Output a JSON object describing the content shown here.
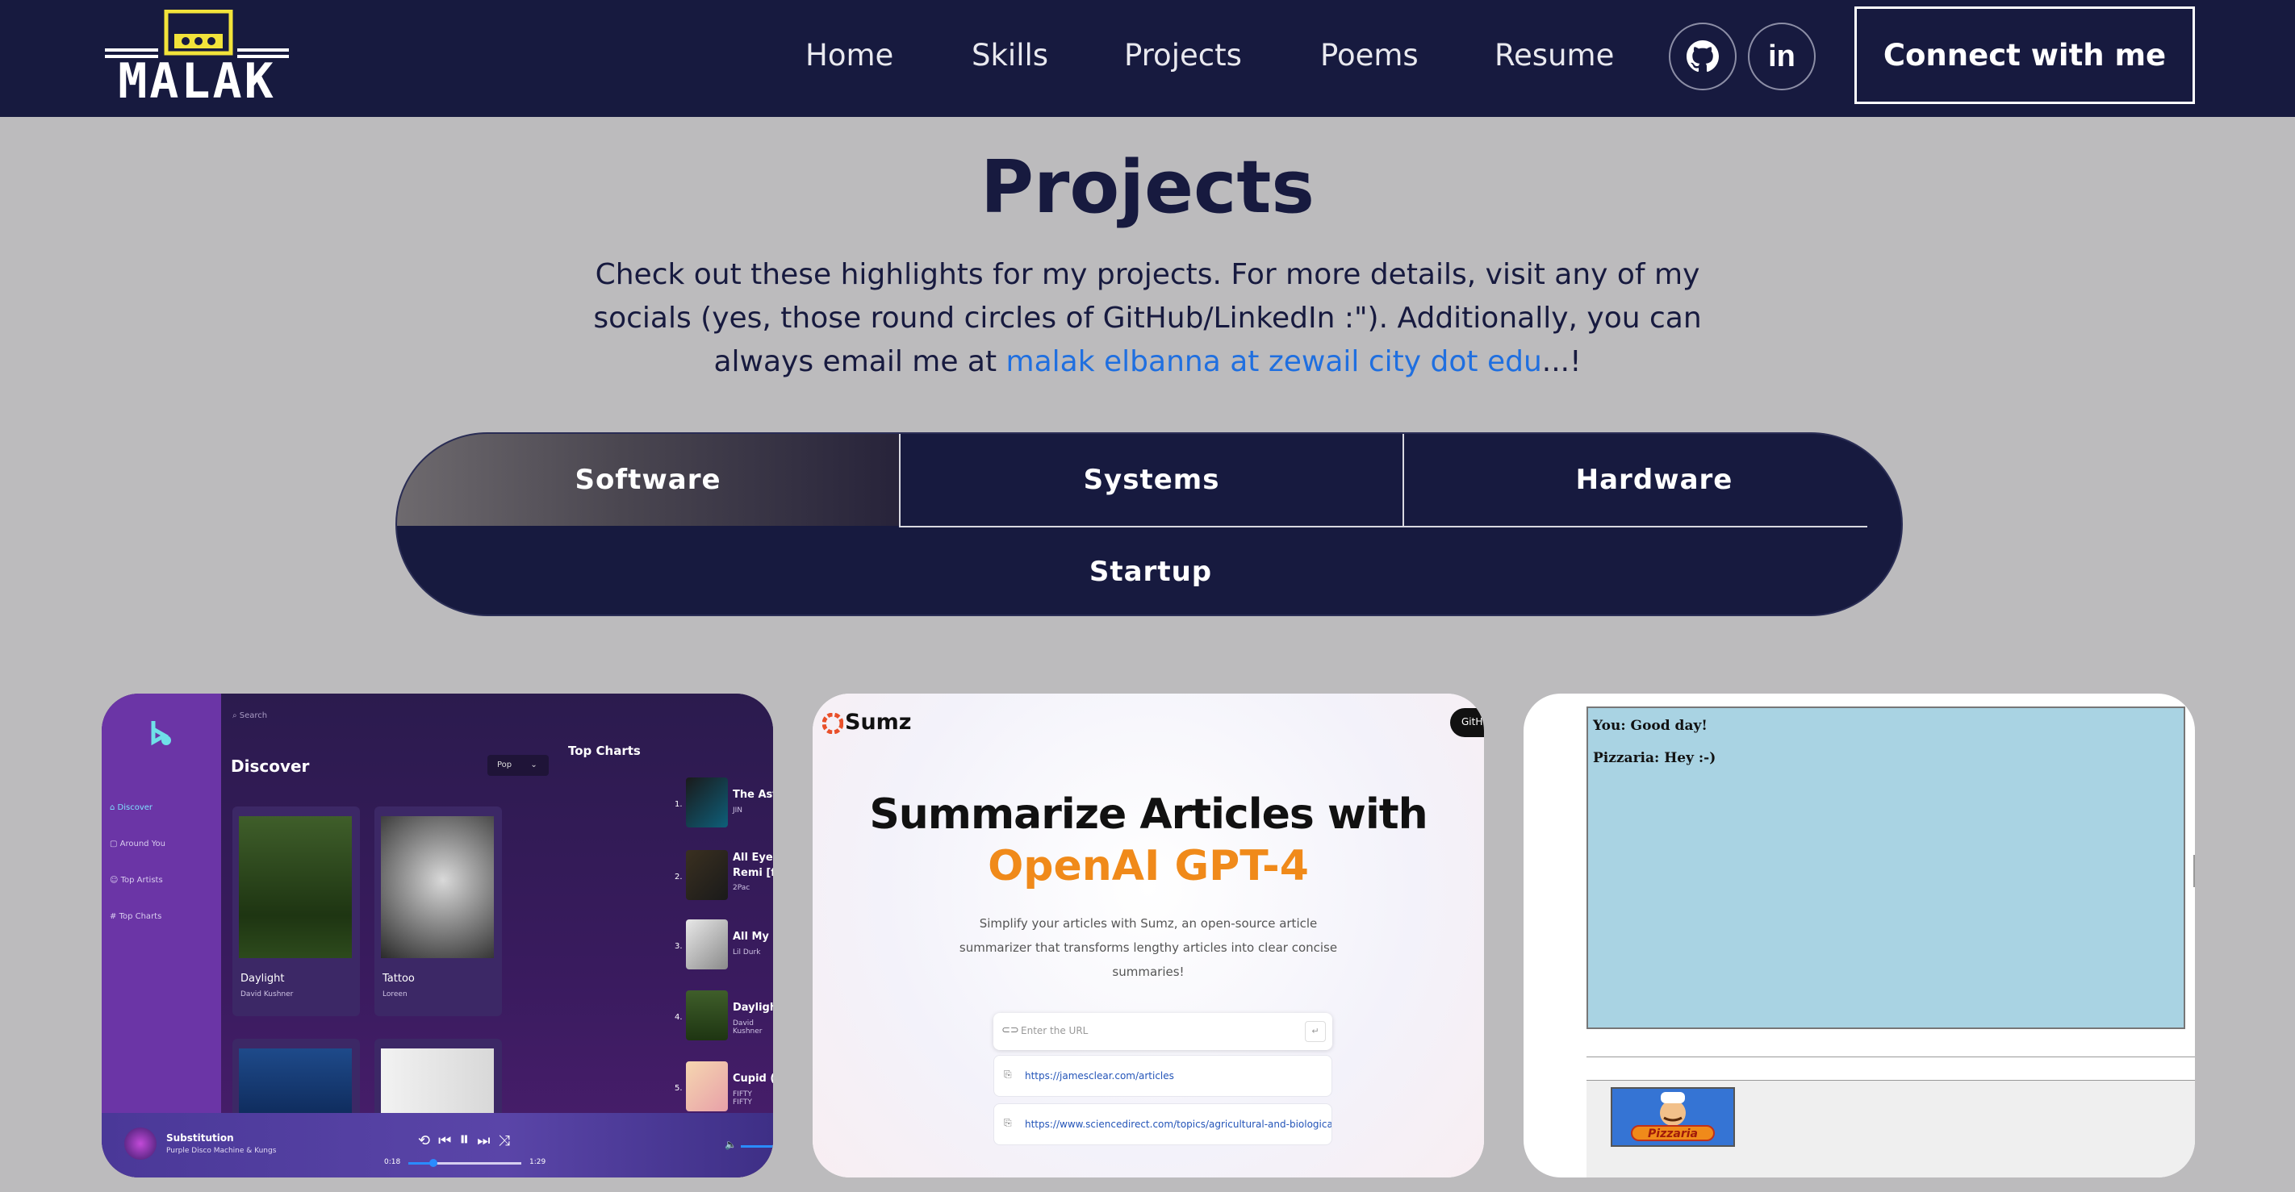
{
  "brand": {
    "name": "MALAK"
  },
  "nav": {
    "links": [
      "Home",
      "Skills",
      "Projects",
      "Poems",
      "Resume"
    ],
    "connect_label": "Connect with me",
    "github_icon": "github-icon",
    "linkedin_icon": "linkedin-icon",
    "linkedin_text": "in"
  },
  "page": {
    "title": "Projects",
    "intro_before": "Check out these highlights for my projects. For more details, visit any of my socials (yes, those round circles of GitHub/LinkedIn :\"). Additionally, you can always email me at ",
    "email_text": "malak elbanna at zewail city dot edu",
    "intro_after": "...!"
  },
  "tabs": {
    "items": [
      "Software",
      "Systems",
      "Hardware",
      "Startup"
    ],
    "active": "Software"
  },
  "cards": {
    "music": {
      "search_placeholder": "Search",
      "title": "Discover",
      "genre": "Pop",
      "sidebar": [
        "Discover",
        "Around You",
        "Top Artists",
        "Top Charts"
      ],
      "tiles": [
        {
          "title": "Daylight",
          "artist": "David Kushner"
        },
        {
          "title": "Tattoo",
          "artist": "Loreen"
        }
      ],
      "top_charts_title": "Top Charts",
      "top_charts": [
        {
          "num": "1.",
          "title": "The Astronaut",
          "artist": "JIN"
        },
        {
          "num": "2.",
          "title": "All Eyez On Me (Dj Belite Remi [feat. Big Syke]",
          "artist": "2Pac"
        },
        {
          "num": "3.",
          "title": "All My Life (feat. J. Cole)",
          "artist": "Lil Durk"
        },
        {
          "num": "4.",
          "title": "Daylight",
          "artist": "David Kushner"
        },
        {
          "num": "5.",
          "title": "Cupid (Twin Ver.)",
          "artist": "FIFTY FIFTY"
        }
      ],
      "player": {
        "song": "Substitution",
        "artist": "Purple Disco Machine & Kungs",
        "elapsed": "0:18",
        "total": "1:29"
      }
    },
    "sumz": {
      "logo": "Sumz",
      "github_label": "GitHu",
      "headline_1": "Summarize Articles with",
      "headline_2": "OpenAI GPT-4",
      "description": "Simplify your articles with Sumz, an open-source article summarizer that transforms lengthy articles into clear concise summaries!",
      "url_placeholder": "Enter the URL",
      "history": [
        "https://jamesclear.com/articles",
        "https://www.sciencedirect.com/topics/agricultural-and-biological-sciences/mol..."
      ]
    },
    "pizzaria": {
      "messages": [
        "You: Good day!",
        "Pizzaria: Hey :-)"
      ],
      "logo_text": "Pizzaria"
    }
  },
  "colors": {
    "navy": "#171a3f",
    "page_bg": "#bcbbbd",
    "link_blue": "#1f6fe0",
    "accent_yellow": "#f2e33a"
  }
}
